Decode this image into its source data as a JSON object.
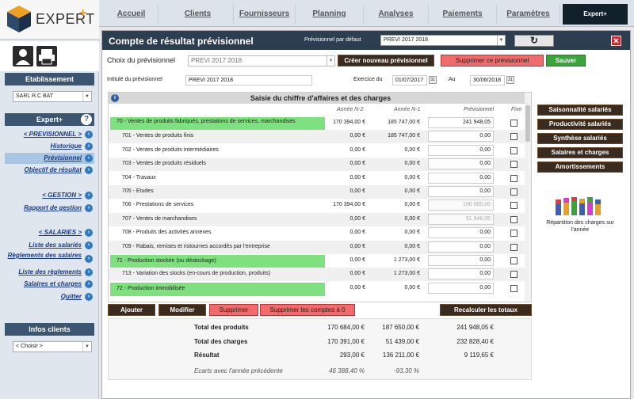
{
  "app": {
    "logo": "EXPERT",
    "logo_plus": "+"
  },
  "topnav": {
    "tabs": [
      "Accueil",
      "Clients",
      "Fournisseurs",
      "Planning",
      "Analyses",
      "Paiements",
      "Paramètres",
      "Expert+"
    ]
  },
  "sidebar": {
    "etablissement_title": "Etablissement",
    "etablissement_value": "SARL R.C BAT",
    "expert_title": "Expert+",
    "items": [
      "< PREVISIONNEL >",
      "Historique",
      "Prévisionnel",
      "Objectif de résultat",
      "< GESTION >",
      "Rapport de gestion",
      "< SALARIES >",
      "Liste des salariés",
      "Règlements des salaires",
      "Liste des règlements",
      "Salaires et charges",
      "Quitter"
    ],
    "infos_title": "Infos clients",
    "infos_value": "< Choisir >"
  },
  "panel": {
    "title": "Compte de résultat prévisionnel",
    "default_label": "Prévisionnel par défaut",
    "default_value": "PREVI 2017 2018",
    "choix_label": "Choix du prévisionnel",
    "choix_value": "PREVI 2017 2018",
    "btn_create": "Créer nouveau prévisionnel",
    "btn_delete": "Supprimer ce prévisionnel",
    "btn_save": "Sauver",
    "intitule_label": "Intitulé du prévisionnel",
    "intitule_value": "PREVI 2017 2018",
    "exercice_label": "Exercice du",
    "exercice_from": "01/07/2017",
    "exercice_au": "Au",
    "exercice_to": "30/06/2018"
  },
  "table": {
    "heading": "Saisie du chiffre d'affaires et des charges",
    "columns": [
      "Année N-2",
      "Année N-1",
      "Prévisionnel",
      "Fixe"
    ],
    "rows": [
      {
        "label": "70 - Ventes de produits fabriqués, prestations de services, marchandises",
        "n2": "170 394,00 €",
        "n1": "185 747,00 €",
        "prev": "241 948,05",
        "head": true
      },
      {
        "label": "701 - Ventes de produits finis",
        "n2": "0,00 €",
        "n1": "185 747,00 €",
        "prev": "0,00"
      },
      {
        "label": "702 - Ventes de produits intermédiaires",
        "n2": "0,00 €",
        "n1": "0,00 €",
        "prev": "0,00"
      },
      {
        "label": "703 - Ventes de produits résiduels",
        "n2": "0,00 €",
        "n1": "0,00 €",
        "prev": "0,00"
      },
      {
        "label": "704 - Travaux",
        "n2": "0,00 €",
        "n1": "0,00 €",
        "prev": "0,00"
      },
      {
        "label": "705 - Etudes",
        "n2": "0,00 €",
        "n1": "0,00 €",
        "prev": "0,00"
      },
      {
        "label": "706 - Prestations de services",
        "n2": "170 394,00 €",
        "n1": "0,00 €",
        "prev": "190 000,00",
        "grey": true
      },
      {
        "label": "707 - Ventes de marchandises",
        "n2": "0,00 €",
        "n1": "0,00 €",
        "prev": "51 948,05",
        "grey": true
      },
      {
        "label": "708 - Produits des activités annexes",
        "n2": "0,00 €",
        "n1": "0,00 €",
        "prev": "0,00"
      },
      {
        "label": "709 - Rabais, remises et ristournes accordés par l'entreprise",
        "n2": "0,00 €",
        "n1": "0,00 €",
        "prev": "0,00"
      },
      {
        "label": "71 - Production stockée (ou déstockage)",
        "n2": "0,00 €",
        "n1": "1 273,00 €",
        "prev": "0,00",
        "head": true
      },
      {
        "label": "713 - Variation des stocks (en-cours de production, produits)",
        "n2": "0,00 €",
        "n1": "1 273,00 €",
        "prev": "0,00"
      },
      {
        "label": "72 - Production immobilisée",
        "n2": "0,00 €",
        "n1": "0,00 €",
        "prev": "0,00",
        "head": true
      }
    ]
  },
  "actions": {
    "add": "Ajouter",
    "edit": "Modifier",
    "delete": "Supprimer",
    "delete_zero": "Supprimer les comptes à 0",
    "recalc": "Recalculer les totaux"
  },
  "totals": {
    "produits_label": "Total des produits",
    "produits": [
      "170 684,00 €",
      "187 650,00 €",
      "241 948,05 €"
    ],
    "charges_label": "Total des charges",
    "charges": [
      "170 391,00 €",
      "51 439,00 €",
      "232 828,40 €"
    ],
    "resultat_label": "Résultat",
    "resultat": [
      "293,00 €",
      "136 211,00 €",
      "9 119,65 €"
    ],
    "ecarts_label": "Ecarts avec l'année précédente",
    "ecarts": [
      "46 388,40 %",
      "-93,30 %"
    ]
  },
  "right_panel": {
    "buttons": [
      "Saisonnalité salariés",
      "Productivité salariés",
      "Synthèse salariés",
      "Salaires et charges",
      "Amortissements"
    ],
    "chart_caption": "Répartition des charges sur l'année"
  }
}
